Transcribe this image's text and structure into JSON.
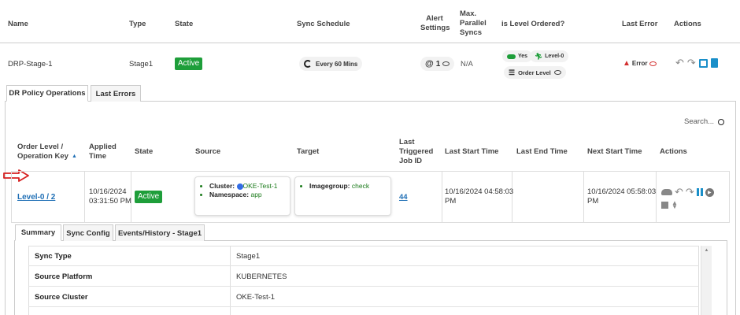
{
  "top_table": {
    "headers": {
      "name": "Name",
      "type": "Type",
      "state": "State",
      "sync_schedule": "Sync Schedule",
      "alert_settings_1": "Alert",
      "alert_settings_2": "Settings",
      "max_parallel_1": "Max.",
      "max_parallel_2": "Parallel",
      "max_parallel_3": "Syncs",
      "level_ordered": "is Level Ordered?",
      "last_error": "Last Error",
      "actions": "Actions"
    },
    "row": {
      "name": "DRP-Stage-1",
      "type": "Stage1",
      "state": "Active",
      "schedule": "Every 60 Mins",
      "alert_count": "1",
      "alert_at": "@",
      "max_parallel": "N/A",
      "yes": "Yes",
      "level": "Level-0",
      "order_level": "Order Level",
      "error": "Error"
    }
  },
  "outer_tabs": [
    "DR Policy Operations",
    "Last Errors"
  ],
  "search": {
    "placeholder": "Search..."
  },
  "ops_table": {
    "headers": {
      "order_level_1": "Order Level /",
      "order_level_2": "Operation Key",
      "applied_1": "Applied",
      "applied_2": "Time",
      "state": "State",
      "source": "Source",
      "target": "Target",
      "last_job_1": "Last",
      "last_job_2": "Triggered",
      "last_job_3": "Job ID",
      "last_start": "Last Start Time",
      "last_end": "Last End Time",
      "next_start": "Next Start Time",
      "actions": "Actions"
    },
    "row": {
      "order_level": "Level-0 / 2",
      "applied_date": "10/16/2024",
      "applied_time": "03:31:50 PM",
      "state": "Active",
      "cluster_label": "Cluster:",
      "cluster_value": "OKE-Test-1",
      "namespace_label": "Namespace:",
      "namespace_value": "app",
      "imagegroup_label": "Imagegroup:",
      "imagegroup_value": "check",
      "job_id": "44",
      "last_start_1": "10/16/2024 04:58:03",
      "last_start_2": "PM",
      "last_end": "",
      "next_start_1": "10/16/2024 05:58:03",
      "next_start_2": "PM"
    }
  },
  "inner_tabs": [
    "Summary",
    "Sync Config",
    "Events/History - Stage1"
  ],
  "summary": [
    {
      "key": "Sync Type",
      "value": "Stage1"
    },
    {
      "key": "Source Platform",
      "value": "KUBERNETES"
    },
    {
      "key": "Source Cluster",
      "value": "OKE-Test-1"
    }
  ],
  "colors": {
    "active_green": "#1e9e3a",
    "link_blue": "#1f6fb5",
    "error_red": "#d32f2f",
    "action_teal": "#1a8fc9",
    "arrow_red": "#d62020"
  }
}
